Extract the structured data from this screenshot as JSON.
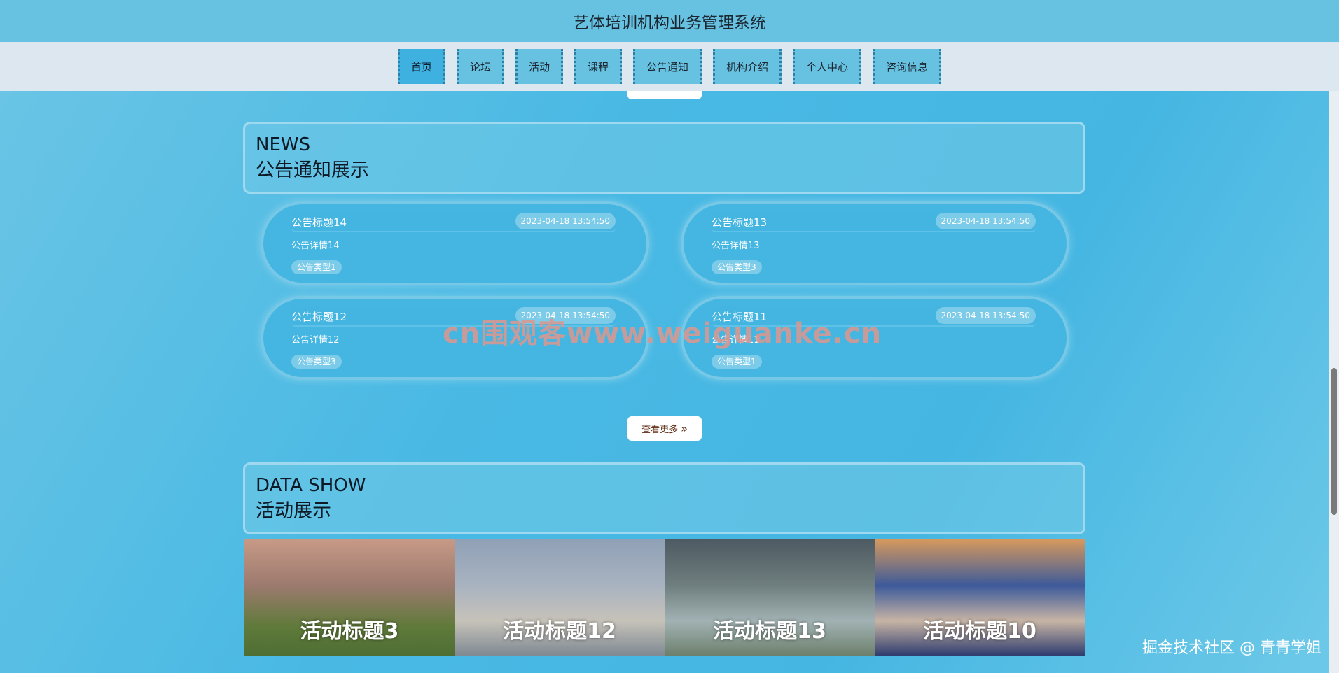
{
  "header": {
    "title": "艺体培训机构业务管理系统"
  },
  "nav": {
    "items": [
      {
        "label": "首页",
        "active": true
      },
      {
        "label": "论坛",
        "active": false
      },
      {
        "label": "活动",
        "active": false
      },
      {
        "label": "课程",
        "active": false
      },
      {
        "label": "公告通知",
        "active": false
      },
      {
        "label": "机构介绍",
        "active": false
      },
      {
        "label": "个人中心",
        "active": false
      },
      {
        "label": "咨询信息",
        "active": false
      }
    ]
  },
  "news": {
    "heading_en": "NEWS",
    "heading_cn": "公告通知展示",
    "notices": [
      {
        "title": "公告标题14",
        "date": "2023-04-18 13:54:50",
        "detail": "公告详情14",
        "type": "公告类型1"
      },
      {
        "title": "公告标题13",
        "date": "2023-04-18 13:54:50",
        "detail": "公告详情13",
        "type": "公告类型3"
      },
      {
        "title": "公告标题12",
        "date": "2023-04-18 13:54:50",
        "detail": "公告详情12",
        "type": "公告类型3"
      },
      {
        "title": "公告标题11",
        "date": "2023-04-18 13:54:50",
        "detail": "公告详情11",
        "type": "公告类型1"
      }
    ],
    "more_label": "查看更多"
  },
  "activities": {
    "heading_en": "DATA SHOW",
    "heading_cn": "活动展示",
    "items": [
      {
        "title": "活动标题3"
      },
      {
        "title": "活动标题12"
      },
      {
        "title": "活动标题13"
      },
      {
        "title": "活动标题10"
      }
    ]
  },
  "overlays": {
    "watermark": "cn围观客www.weiguanke.cn",
    "community_mark": "掘金技术社区 @ 青青学姐"
  },
  "colors": {
    "background": "#45b6e2",
    "topbar": "#67c1e0",
    "navbar": "#dce7ef",
    "nav_active": "#3fb1e0"
  },
  "icons": {
    "more": "double-chevron-right-icon"
  }
}
